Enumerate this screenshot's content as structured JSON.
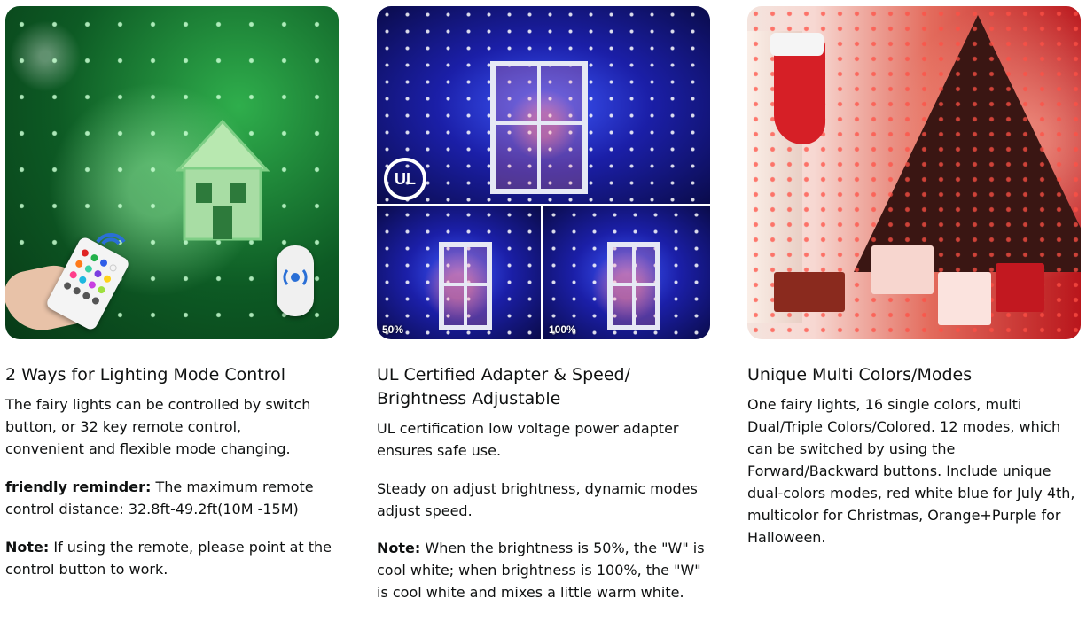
{
  "columns": [
    {
      "image_alt": "green fairy lights on tree with remote and switch",
      "title": "2 Ways for Lighting Mode Control",
      "paragraphs": [
        {
          "bold": "",
          "text": "The fairy lights can be controlled by switch button, or 32 key remote control, convenient and flexible mode changing."
        },
        {
          "bold": "friendly reminder:",
          "text": " The maximum remote control distance: 32.8ft-49.2ft(10M -15M)"
        },
        {
          "bold": "Note:",
          "text": " If using the remote, please point at the control button to work."
        }
      ]
    },
    {
      "image_alt": "blue fairy lights around lantern",
      "badge": "UL",
      "brightness_labels": [
        "50%",
        "100%"
      ],
      "title": "UL Certified Adapter & Speed/ Brightness Adjustable",
      "paragraphs": [
        {
          "bold": "",
          "text": "UL certification low voltage power adapter ensures safe use."
        },
        {
          "bold": "",
          "text": "Steady on adjust brightness, dynamic modes adjust speed."
        },
        {
          "bold": "Note:",
          "text": " When the brightness is 50%, the \"W\" is cool white; when brightness is 100%, the \"W\" is cool white and mixes a little warm white."
        }
      ]
    },
    {
      "image_alt": "red fairy lights on christmas tree",
      "title": "Unique Multi Colors/Modes",
      "paragraphs": [
        {
          "bold": "",
          "text": "One fairy lights, 16 single colors, multi Dual/Triple Colors/Colored. 12 modes, which can be switched by using the Forward/Backward buttons. Include unique dual-colors modes, red white blue for July 4th, multicolor for Christmas, Orange+Purple for Halloween."
        }
      ]
    }
  ]
}
